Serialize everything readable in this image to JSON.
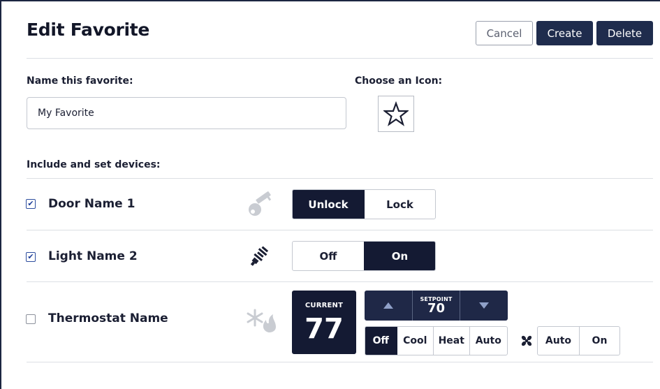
{
  "header": {
    "title": "Edit Favorite",
    "cancel_label": "Cancel",
    "create_label": "Create",
    "delete_label": "Delete"
  },
  "form": {
    "name_label": "Name this favorite:",
    "name_value": "My Favorite",
    "icon_label": "Choose an Icon:",
    "icon": "star-outline-icon",
    "devices_label": "Include and set devices:"
  },
  "devices": [
    {
      "name": "Door Name 1",
      "checked": true,
      "icon": "key-icon",
      "options": [
        "Unlock",
        "Lock"
      ],
      "selected": "Unlock"
    },
    {
      "name": "Light Name 2",
      "checked": true,
      "icon": "light-bulb-icon",
      "options": [
        "Off",
        "On"
      ],
      "selected": "On"
    },
    {
      "name": "Thermostat Name",
      "checked": false,
      "icon": "snowflake-flame-icon",
      "current_label": "CURRENT",
      "current_value": "77",
      "setpoint_label": "SETPOINT",
      "setpoint_value": "70",
      "modes": [
        "Off",
        "Cool",
        "Heat",
        "Auto"
      ],
      "mode_selected": "Off",
      "fan_icon": "fan-icon",
      "fan_options": [
        "Auto",
        "On"
      ]
    }
  ],
  "colors": {
    "primary": "#1f2c4d",
    "active_segment": "#141a33",
    "divider": "#dcdfe4",
    "checkbox_tick": "#1e3f9a"
  }
}
